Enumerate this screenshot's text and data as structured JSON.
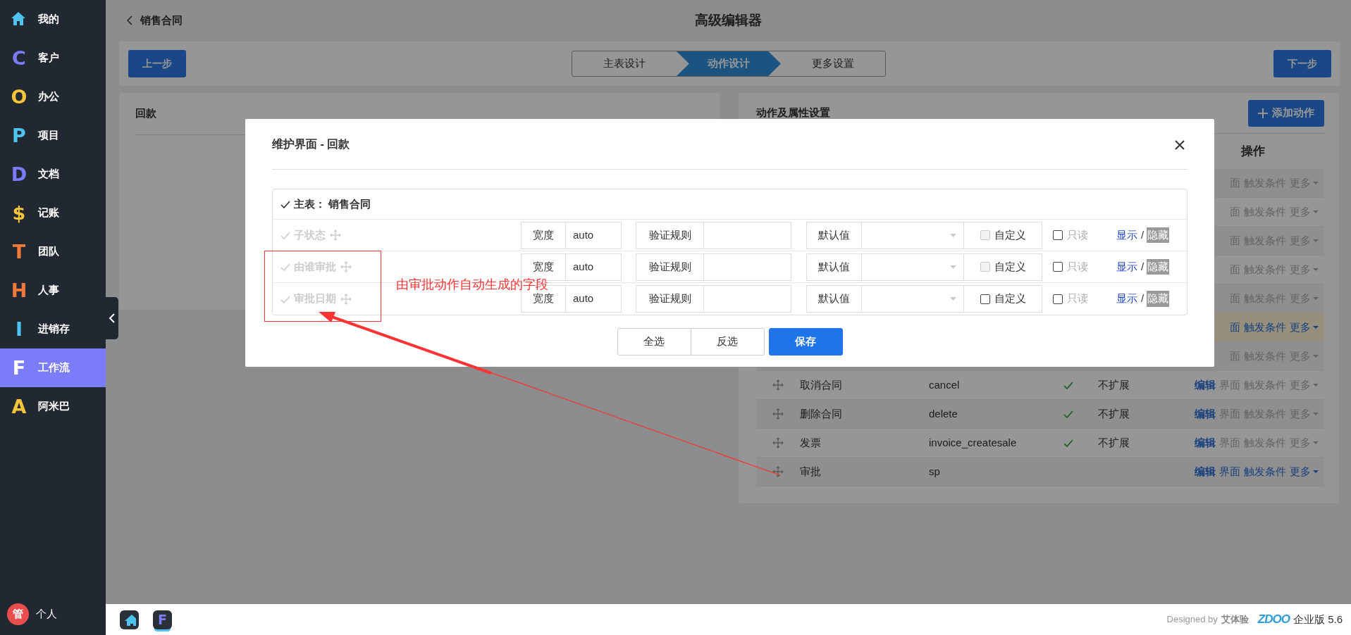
{
  "sidebar": {
    "items": [
      {
        "kind": "home",
        "label": "我的",
        "color": "#4ec3f0",
        "selected": false
      },
      {
        "letter": "C",
        "label": "客户",
        "color": "#7b7cf7",
        "selected": false
      },
      {
        "letter": "O",
        "label": "办公",
        "color": "#f4c53b",
        "selected": false
      },
      {
        "letter": "P",
        "label": "项目",
        "color": "#4ec3f0",
        "selected": false
      },
      {
        "letter": "D",
        "label": "文档",
        "color": "#7b7cf7",
        "selected": false
      },
      {
        "letter": "$",
        "label": "记账",
        "color": "#f4c53b",
        "selected": false
      },
      {
        "letter": "T",
        "label": "团队",
        "color": "#f47a3b",
        "selected": false
      },
      {
        "letter": "H",
        "label": "人事",
        "color": "#f47a3b",
        "selected": false
      },
      {
        "letter": "I",
        "label": "进销存",
        "color": "#4ec3f0",
        "selected": false
      },
      {
        "letter": "F",
        "label": "工作流",
        "color": "#ffffff",
        "selected": true
      },
      {
        "letter": "A",
        "label": "阿米巴",
        "color": "#f4c53b",
        "selected": false
      }
    ],
    "user": {
      "avatar": "管",
      "label": "个人"
    }
  },
  "header": {
    "back_label": "销售合同",
    "title": "高级编辑器"
  },
  "toolbar": {
    "prev": "上一步",
    "next": "下一步",
    "steps": [
      {
        "label": "主表设计",
        "selected": false
      },
      {
        "label": "动作设计",
        "selected": true
      },
      {
        "label": "更多设置",
        "selected": false
      }
    ]
  },
  "left_panel": {
    "title": "回款"
  },
  "right_panel": {
    "title": "动作及属性设置",
    "add_button": "添加动作",
    "op_header": "操作",
    "rows": [
      {
        "highlight": false,
        "ops": [
          {
            "label": "面",
            "active": false
          },
          {
            "label": "触发条件",
            "active": false
          },
          {
            "label": "更多",
            "active": false,
            "kind": "dropdown"
          }
        ]
      },
      {
        "highlight": false,
        "ops": [
          {
            "label": "面",
            "active": false
          },
          {
            "label": "触发条件",
            "active": false
          },
          {
            "label": "更多",
            "active": false,
            "kind": "dropdown"
          }
        ]
      },
      {
        "highlight": false,
        "ops": [
          {
            "label": "面",
            "active": false
          },
          {
            "label": "触发条件",
            "active": false
          },
          {
            "label": "更多",
            "active": false,
            "kind": "dropdown"
          }
        ]
      },
      {
        "highlight": false,
        "ops": [
          {
            "label": "面",
            "active": false
          },
          {
            "label": "触发条件",
            "active": false
          },
          {
            "label": "更多",
            "active": false,
            "kind": "dropdown"
          }
        ]
      },
      {
        "highlight": false,
        "ops": [
          {
            "label": "面",
            "active": false
          },
          {
            "label": "触发条件",
            "active": false
          },
          {
            "label": "更多",
            "active": false,
            "kind": "dropdown"
          }
        ]
      },
      {
        "highlight": true,
        "ops": [
          {
            "label": "面",
            "active": true
          },
          {
            "label": "触发条件",
            "active": true
          },
          {
            "label": "更多",
            "active": true,
            "kind": "dropdown"
          }
        ]
      },
      {
        "highlight": false,
        "ops": [
          {
            "label": "面",
            "active": false
          },
          {
            "label": "触发条件",
            "active": false
          },
          {
            "label": "更多",
            "active": false,
            "kind": "dropdown"
          }
        ]
      },
      {
        "highlight": false,
        "name": "取消合同",
        "code": "cancel",
        "checked": true,
        "expand": "不扩展",
        "ops": [
          {
            "label": "编辑",
            "active": true
          },
          {
            "label": "界面",
            "active": false
          },
          {
            "label": "触发条件",
            "active": false
          },
          {
            "label": "更多",
            "active": false,
            "kind": "dropdown"
          }
        ]
      },
      {
        "highlight": false,
        "name": "删除合同",
        "code": "delete",
        "checked": true,
        "expand": "不扩展",
        "ops": [
          {
            "label": "编辑",
            "active": true
          },
          {
            "label": "界面",
            "active": false
          },
          {
            "label": "触发条件",
            "active": false
          },
          {
            "label": "更多",
            "active": false,
            "kind": "dropdown"
          }
        ]
      },
      {
        "highlight": false,
        "name": "发票",
        "code": "invoice_createsale",
        "checked": true,
        "expand": "不扩展",
        "ops": [
          {
            "label": "编辑",
            "active": true
          },
          {
            "label": "界面",
            "active": false
          },
          {
            "label": "触发条件",
            "active": false
          },
          {
            "label": "更多",
            "active": false,
            "kind": "dropdown"
          }
        ]
      },
      {
        "highlight": false,
        "name": "审批",
        "code": "sp",
        "checked": false,
        "ops": [
          {
            "label": "编辑",
            "active": true
          },
          {
            "label": "界面",
            "active": true
          },
          {
            "label": "触发条件",
            "active": true
          },
          {
            "label": "更多",
            "active": true,
            "kind": "dropdown"
          }
        ]
      }
    ]
  },
  "modal": {
    "title": "维护界面 - 回款",
    "table_title": "主表： 销售合同",
    "fields": [
      {
        "name": "子状态",
        "enabled": false,
        "width_label": "宽度",
        "width_value": "auto",
        "rule_label": "验证规则",
        "default_label": "默认值",
        "custom": {
          "label": "自定义",
          "checked": false,
          "disabled": true
        },
        "readonly": {
          "label": "只读",
          "checked": false
        },
        "separator": "/",
        "display": [
          {
            "label": "显示",
            "selected": false
          },
          {
            "label": "隐藏",
            "selected": true
          }
        ]
      },
      {
        "name": "由谁审批",
        "enabled": false,
        "width_label": "宽度",
        "width_value": "auto",
        "rule_label": "验证规则",
        "default_label": "默认值",
        "custom": {
          "label": "自定义",
          "checked": false,
          "disabled": true
        },
        "readonly": {
          "label": "只读",
          "checked": false
        },
        "separator": "/",
        "display": [
          {
            "label": "显示",
            "selected": false
          },
          {
            "label": "隐藏",
            "selected": true
          }
        ]
      },
      {
        "name": "审批日期",
        "enabled": false,
        "width_label": "宽度",
        "width_value": "auto",
        "rule_label": "验证规则",
        "default_label": "默认值",
        "custom": {
          "label": "自定义",
          "checked": false,
          "disabled": false
        },
        "readonly": {
          "label": "只读",
          "checked": false
        },
        "separator": "/",
        "display": [
          {
            "label": "显示",
            "selected": false
          },
          {
            "label": "隐藏",
            "selected": true
          }
        ]
      }
    ],
    "buttons": [
      {
        "label": "全选",
        "kind": "outline"
      },
      {
        "label": "反选",
        "kind": "outline"
      },
      {
        "label": "保存",
        "kind": "primary"
      }
    ]
  },
  "annotation": {
    "text": "由审批动作自动生成的字段"
  },
  "taskbar": {
    "apps": [
      {
        "kind": "home",
        "active": false
      },
      {
        "letter": "F",
        "active": true
      }
    ],
    "credit": "Designed by",
    "credit_name": "艾体验",
    "logo": "ZDOO",
    "edition": "企业版 5.6"
  }
}
